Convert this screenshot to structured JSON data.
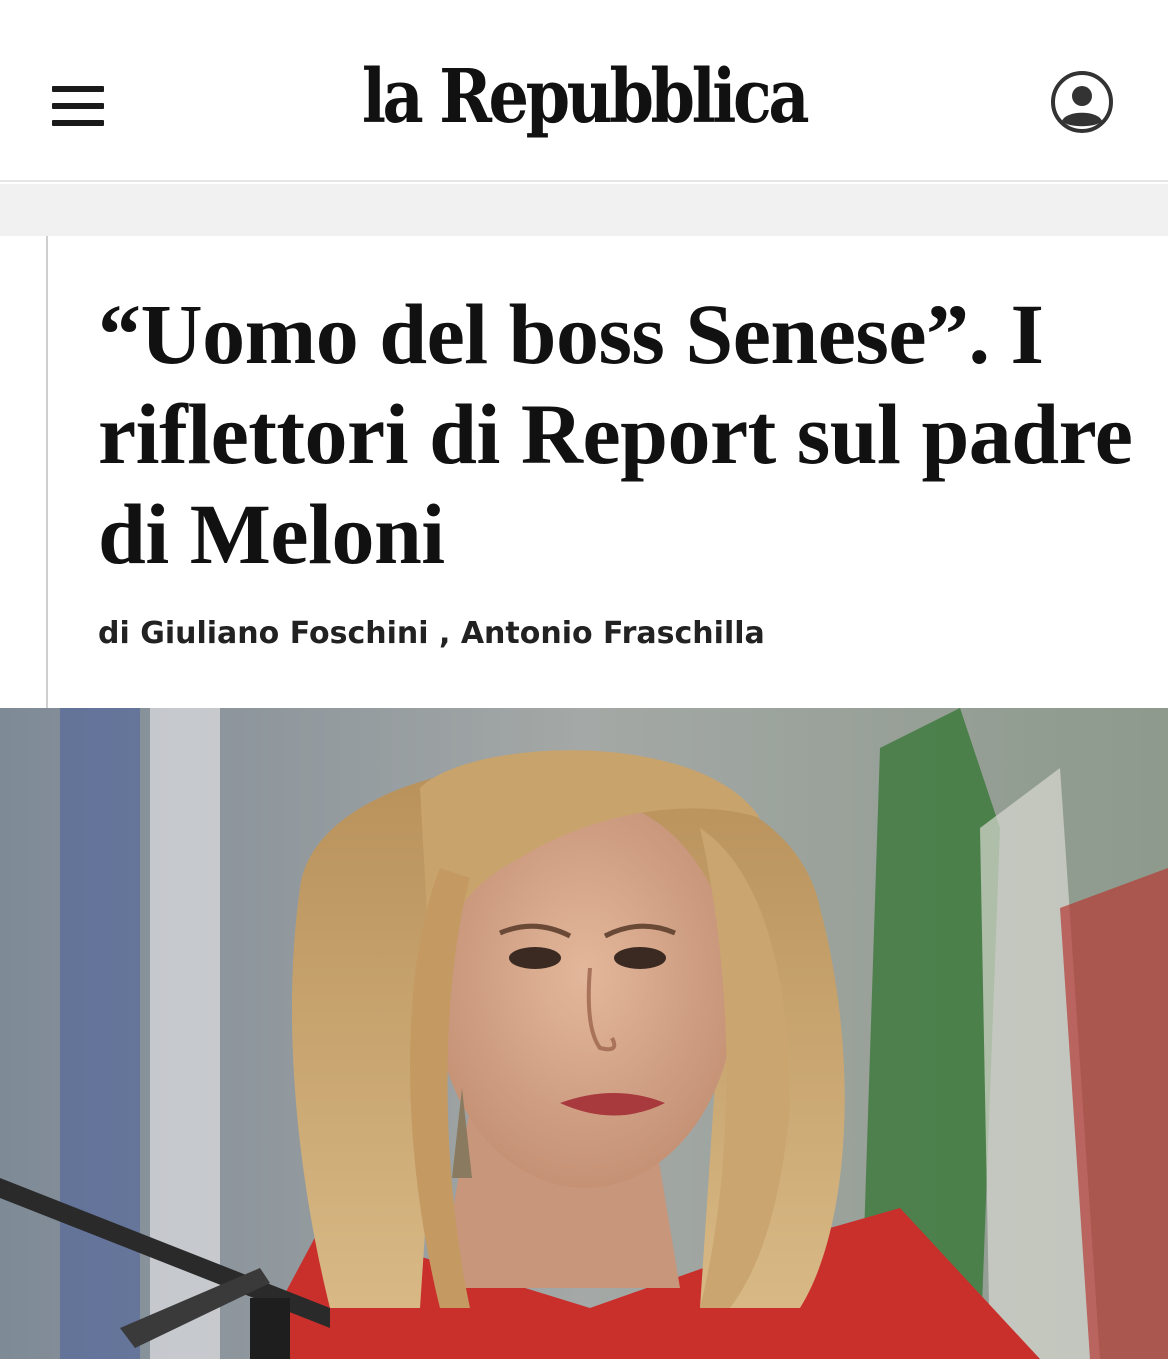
{
  "header": {
    "logo_text": "la Repubblica",
    "menu_icon": "hamburger-menu-icon",
    "account_icon": "user-account-icon"
  },
  "article": {
    "headline": "“Uomo del boss Senese”. I riflettori di Report sul padre di Meloni",
    "byline_prefix": "di",
    "authors": [
      "Giuliano Foschini",
      "Antonio Fraschilla"
    ],
    "author_separator": ","
  },
  "colors": {
    "text": "#111111",
    "header_border": "#e6e6e6",
    "band": "#f1f1f1",
    "rule": "#cfcfcf"
  }
}
